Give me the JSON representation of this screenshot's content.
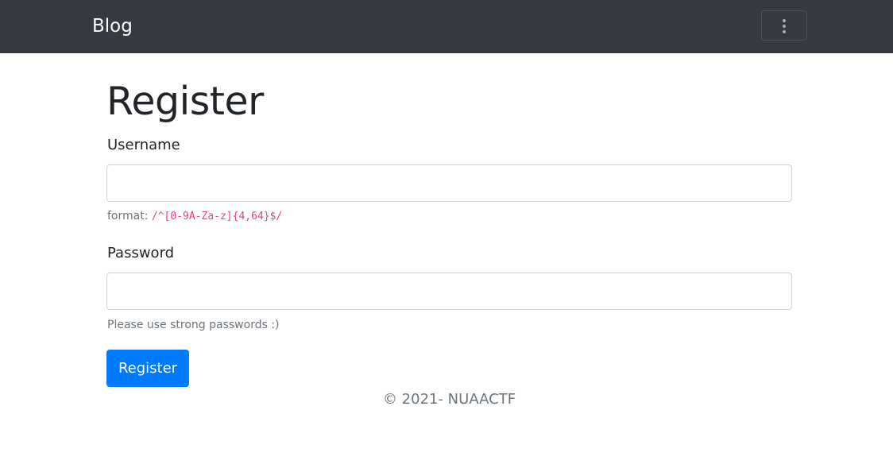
{
  "navbar": {
    "brand": "Blog",
    "toggler_icon": "vertical-ellipsis-icon"
  },
  "form": {
    "title": "Register",
    "username": {
      "label": "Username",
      "value": "",
      "placeholder": "",
      "help_prefix": "format: ",
      "help_pattern": "/^[0-9A-Za-z]{4,64}$/"
    },
    "password": {
      "label": "Password",
      "value": "",
      "placeholder": "",
      "help": "Please use strong passwords :)"
    },
    "submit_label": "Register"
  },
  "footer": {
    "text": "© 2021- NUAACTF"
  },
  "colors": {
    "navbar_bg": "#343a40",
    "primary": "#007bff",
    "code": "#e83e8c",
    "muted": "#6c757d"
  }
}
